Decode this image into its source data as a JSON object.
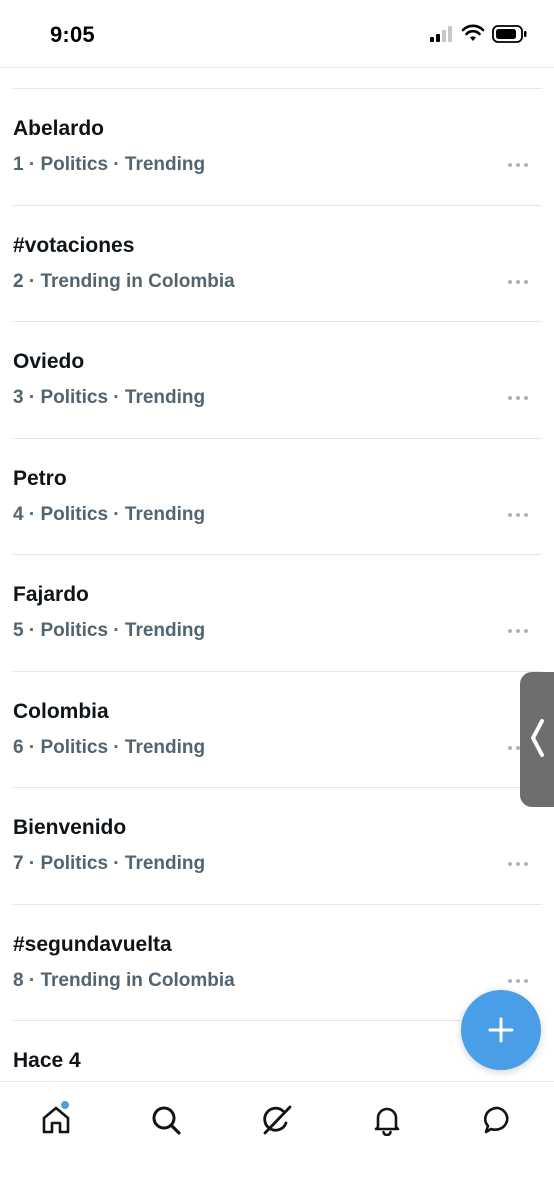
{
  "status_bar": {
    "time": "9:05"
  },
  "trends": [
    {
      "name": "Abelardo",
      "meta": "1 · Politics · Trending"
    },
    {
      "name": "#votaciones",
      "meta": "2 · Trending in Colombia"
    },
    {
      "name": "Oviedo",
      "meta": "3 · Politics · Trending"
    },
    {
      "name": "Petro",
      "meta": "4 · Politics · Trending"
    },
    {
      "name": "Fajardo",
      "meta": "5 · Politics · Trending"
    },
    {
      "name": "Colombia",
      "meta": "6 · Politics · Trending"
    },
    {
      "name": "Bienvenido",
      "meta": "7 · Politics · Trending"
    },
    {
      "name": "#segundavuelta",
      "meta": "8 · Trending in Colombia"
    },
    {
      "name": "Hace 4",
      "meta": ""
    }
  ],
  "bottom_nav": [
    "home-icon",
    "search-icon",
    "grok-icon",
    "notifications-icon",
    "messages-icon"
  ],
  "colors": {
    "accent": "#4a9ee8",
    "meta_text": "#536471",
    "primary_text": "#0f1419"
  }
}
